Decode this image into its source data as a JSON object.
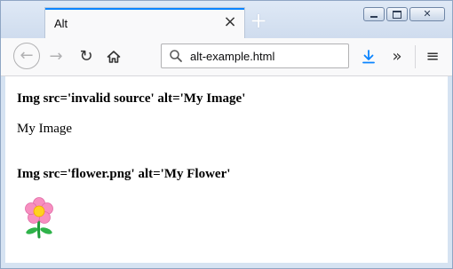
{
  "tab": {
    "title": "Alt",
    "close_symbol": "×",
    "new_tab_symbol": "+"
  },
  "window_controls": {
    "minimize_icon": "minimize-icon",
    "maximize_icon": "maximize-icon",
    "close_symbol": "✕"
  },
  "toolbar": {
    "back_symbol": "←",
    "forward_symbol": "→",
    "reload_symbol": "↻",
    "url": "alt-example.html",
    "overflow_symbol": "»",
    "menu_symbol": "≡"
  },
  "content": {
    "heading_invalid": "Img src='invalid source' alt='My Image'",
    "alt_text": "My Image",
    "heading_flower": "Img src='flower.png' alt='My Flower'"
  },
  "colors": {
    "accent": "#0a84ff",
    "window_frame": "#d6e3f2"
  }
}
